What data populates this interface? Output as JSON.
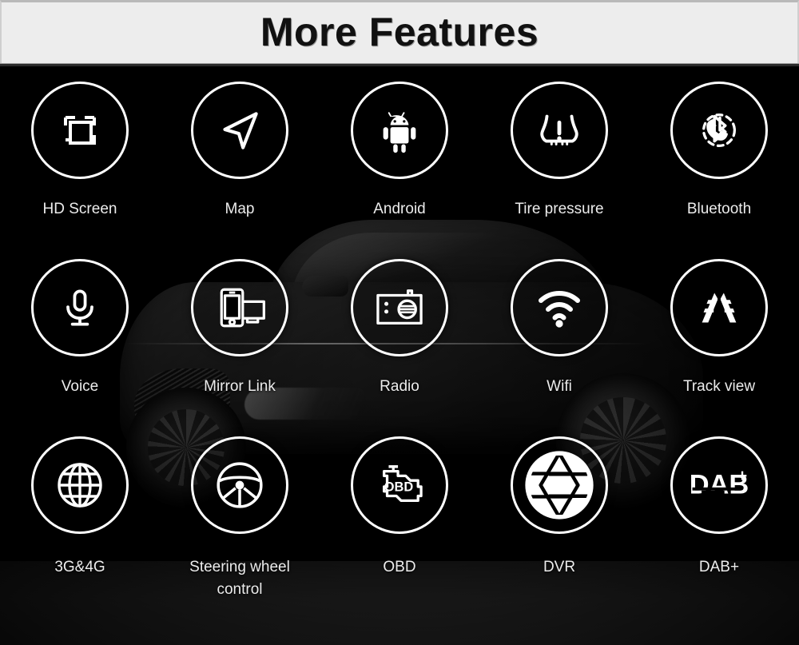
{
  "header": {
    "title": "More Features",
    "background": "#ededed",
    "text_color": "#111111"
  },
  "theme": {
    "page_background": "#000000",
    "icon_stroke": "#ffffff",
    "label_color": "#ececec"
  },
  "background_scene": {
    "description": "dark sports car photo",
    "name": "car-background-image"
  },
  "features": [
    {
      "label": "HD Screen",
      "icon": "hd-screen-icon"
    },
    {
      "label": "Map",
      "icon": "navigation-arrow-icon"
    },
    {
      "label": "Android",
      "icon": "android-robot-icon"
    },
    {
      "label": "Tire pressure",
      "icon": "tire-pressure-warning-icon"
    },
    {
      "label": "Bluetooth",
      "icon": "bluetooth-phone-icon"
    },
    {
      "label": "Voice",
      "icon": "microphone-icon"
    },
    {
      "label": "Mirror Link",
      "icon": "mirror-link-icon"
    },
    {
      "label": "Radio",
      "icon": "radio-icon"
    },
    {
      "label": "Wifi",
      "icon": "wifi-icon"
    },
    {
      "label": "Track view",
      "icon": "track-view-icon"
    },
    {
      "label": "3G&4G",
      "icon": "globe-icon"
    },
    {
      "label": "Steering wheel control",
      "icon": "steering-wheel-icon"
    },
    {
      "label": "OBD",
      "icon": "obd-engine-icon"
    },
    {
      "label": "DVR",
      "icon": "camera-aperture-icon"
    },
    {
      "label": "DAB+",
      "icon": "dab-plus-icon"
    }
  ],
  "icon_text": {
    "obd": "OBD",
    "dab": "DAB",
    "dab_plus": "+"
  }
}
